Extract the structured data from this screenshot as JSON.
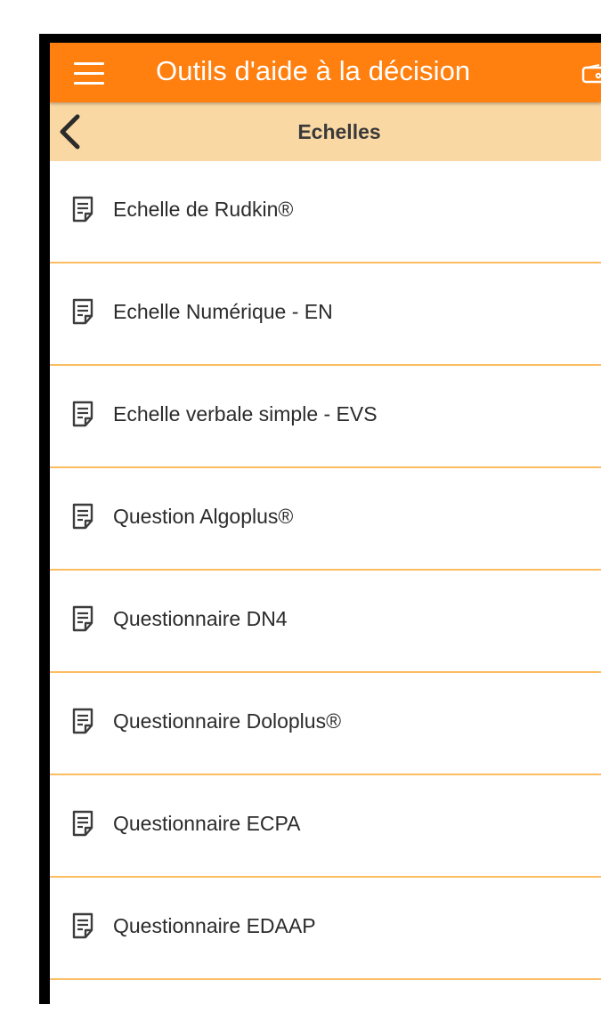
{
  "appbar": {
    "title": "Outils d'aide à la décision",
    "background_color": "#ff7f0f",
    "menu_icon": "hamburger-menu-icon",
    "right_icon": "wallet-icon"
  },
  "subbar": {
    "title": "Echelles",
    "background_color": "#fad8a3",
    "back_icon": "chevron-left-icon"
  },
  "list": {
    "item_icon": "document-icon",
    "divider_color": "#fbbd60",
    "items": [
      {
        "label": "Echelle de Rudkin®"
      },
      {
        "label": "Echelle Numérique - EN"
      },
      {
        "label": "Echelle verbale simple - EVS"
      },
      {
        "label": "Question Algoplus®"
      },
      {
        "label": "Questionnaire DN4"
      },
      {
        "label": "Questionnaire Doloplus®"
      },
      {
        "label": "Questionnaire ECPA"
      },
      {
        "label": "Questionnaire EDAAP"
      }
    ]
  }
}
